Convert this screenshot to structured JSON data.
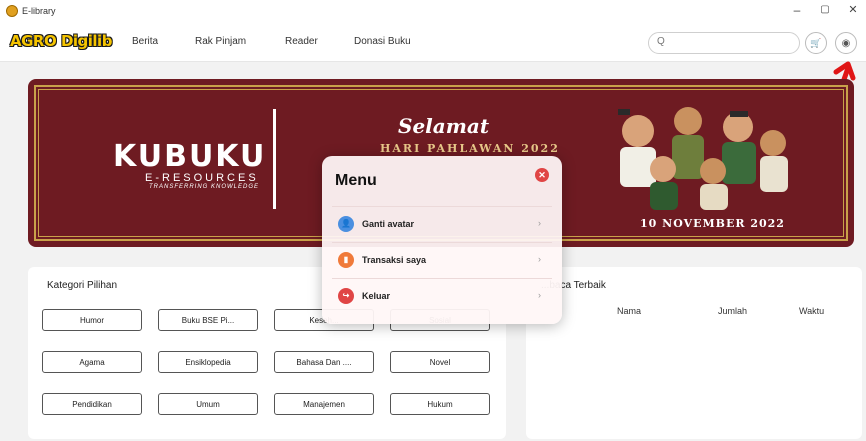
{
  "window": {
    "title": "E-library",
    "minimize": "–",
    "maximize": "▢",
    "close": "✕"
  },
  "nav": {
    "logo": "AGRO Digilib",
    "links": [
      "Berita",
      "Rak Pinjam",
      "Reader",
      "Donasi Buku"
    ],
    "search_placeholder": "",
    "search_icon": "Q",
    "cart_icon": "🛒",
    "user_icon": "◉"
  },
  "banner": {
    "brand_name": "KUBUKU",
    "brand_sub": "E-RESOURCES",
    "brand_tag": "TRANSFERRING KNOWLEDGE",
    "greeting": "Selamat",
    "event": "HARI PAHLAWAN 2022",
    "date": "10 NOVEMBER 2022"
  },
  "kategori": {
    "title": "Kategori Pilihan",
    "buttons": [
      "Humor",
      "Buku BSE Pi...",
      "Keseh...",
      "Sosial",
      "Agama",
      "Ensiklopedia",
      "Bahasa Dan ....",
      "Novel",
      "Pendidikan",
      "Umum",
      "Manajemen",
      "Hukum"
    ]
  },
  "pembaca": {
    "title": "...baca Terbaik",
    "columns": [
      "Nama",
      "Jumlah",
      "Waktu"
    ]
  },
  "menu": {
    "title": "Menu",
    "close_icon": "✕",
    "items": [
      {
        "label": "Ganti avatar",
        "icon": "👤",
        "color": "#4a8fe0"
      },
      {
        "label": "Transaksi saya",
        "icon": "▮",
        "color": "#f07a3a"
      },
      {
        "label": "Keluar",
        "icon": "↪",
        "color": "#e04545"
      }
    ],
    "chevron": "›"
  }
}
